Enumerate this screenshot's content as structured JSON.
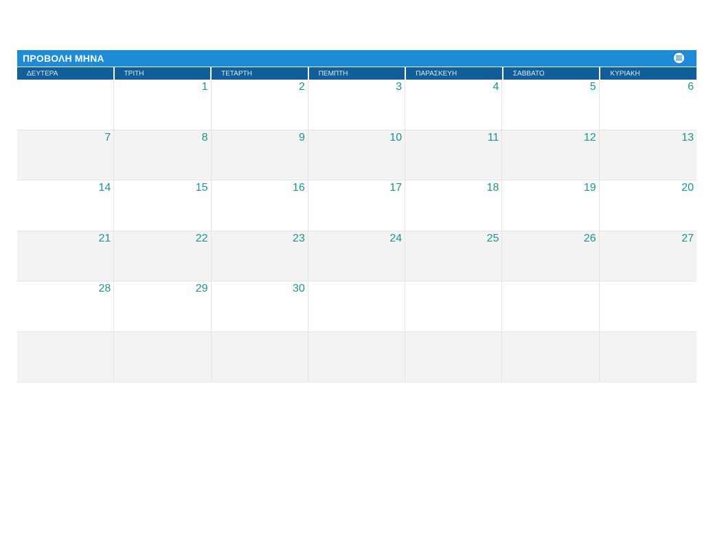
{
  "calendar": {
    "title": "ΠΡΟΒΟΛΗ ΜΗΝΑ",
    "menu_icon": "menu-icon",
    "weekdays": [
      "ΔΕΥΤΕΡΑ",
      "ΤΡΙΤΗ",
      "ΤΕΤΑΡΤΗ",
      "ΠΕΜΠΤΗ",
      "ΠΑΡΑΣΚΕΥΗ",
      "ΣΑΒΒΑΤΟ",
      "ΚΥΡΙΑΚΗ"
    ],
    "weeks": [
      [
        "",
        "1",
        "2",
        "3",
        "4",
        "5",
        "6"
      ],
      [
        "7",
        "8",
        "9",
        "10",
        "11",
        "12",
        "13"
      ],
      [
        "14",
        "15",
        "16",
        "17",
        "18",
        "19",
        "20"
      ],
      [
        "21",
        "22",
        "23",
        "24",
        "25",
        "26",
        "27"
      ],
      [
        "28",
        "29",
        "30",
        "",
        "",
        "",
        ""
      ],
      [
        "",
        "",
        "",
        "",
        "",
        "",
        ""
      ]
    ]
  },
  "colors": {
    "title_bar": "#1f8ad6",
    "weekday_header": "#115e99",
    "date_number": "#1a948c",
    "alt_row": "#f3f3f3"
  }
}
